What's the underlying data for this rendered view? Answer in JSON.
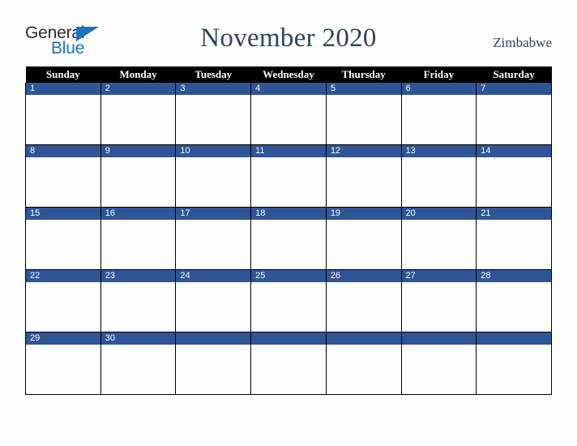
{
  "brand": {
    "word_one": "General",
    "word_two": "Blue",
    "triangle_icon": "blue-triangle-icon",
    "color_dark": "#2b2b2b",
    "color_blue": "#1a72c0"
  },
  "header": {
    "title": "November 2020",
    "country": "Zimbabwe",
    "title_color": "#2d4269"
  },
  "calendar": {
    "weekday_headers": [
      "Sunday",
      "Monday",
      "Tuesday",
      "Wednesday",
      "Thursday",
      "Friday",
      "Saturday"
    ],
    "header_bg": "#000000",
    "header_text_color": "#ffffff",
    "daynum_bg": "#2f5596",
    "daynum_text_color": "#ffffff",
    "cell_bg": "#fdfdfd",
    "grid_line_color": "#000000",
    "weeks": [
      {
        "days": [
          {
            "num": "1",
            "empty": false
          },
          {
            "num": "2",
            "empty": false
          },
          {
            "num": "3",
            "empty": false
          },
          {
            "num": "4",
            "empty": false
          },
          {
            "num": "5",
            "empty": false
          },
          {
            "num": "6",
            "empty": false
          },
          {
            "num": "7",
            "empty": false
          }
        ]
      },
      {
        "days": [
          {
            "num": "8",
            "empty": false
          },
          {
            "num": "9",
            "empty": false
          },
          {
            "num": "10",
            "empty": false
          },
          {
            "num": "11",
            "empty": false
          },
          {
            "num": "12",
            "empty": false
          },
          {
            "num": "13",
            "empty": false
          },
          {
            "num": "14",
            "empty": false
          }
        ]
      },
      {
        "days": [
          {
            "num": "15",
            "empty": false
          },
          {
            "num": "16",
            "empty": false
          },
          {
            "num": "17",
            "empty": false
          },
          {
            "num": "18",
            "empty": false
          },
          {
            "num": "19",
            "empty": false
          },
          {
            "num": "20",
            "empty": false
          },
          {
            "num": "21",
            "empty": false
          }
        ]
      },
      {
        "days": [
          {
            "num": "22",
            "empty": false
          },
          {
            "num": "23",
            "empty": false
          },
          {
            "num": "24",
            "empty": false
          },
          {
            "num": "25",
            "empty": false
          },
          {
            "num": "26",
            "empty": false
          },
          {
            "num": "27",
            "empty": false
          },
          {
            "num": "28",
            "empty": false
          }
        ]
      },
      {
        "days": [
          {
            "num": "29",
            "empty": false
          },
          {
            "num": "30",
            "empty": false
          },
          {
            "num": "",
            "empty": true
          },
          {
            "num": "",
            "empty": true
          },
          {
            "num": "",
            "empty": true
          },
          {
            "num": "",
            "empty": true
          },
          {
            "num": "",
            "empty": true
          }
        ]
      }
    ]
  }
}
